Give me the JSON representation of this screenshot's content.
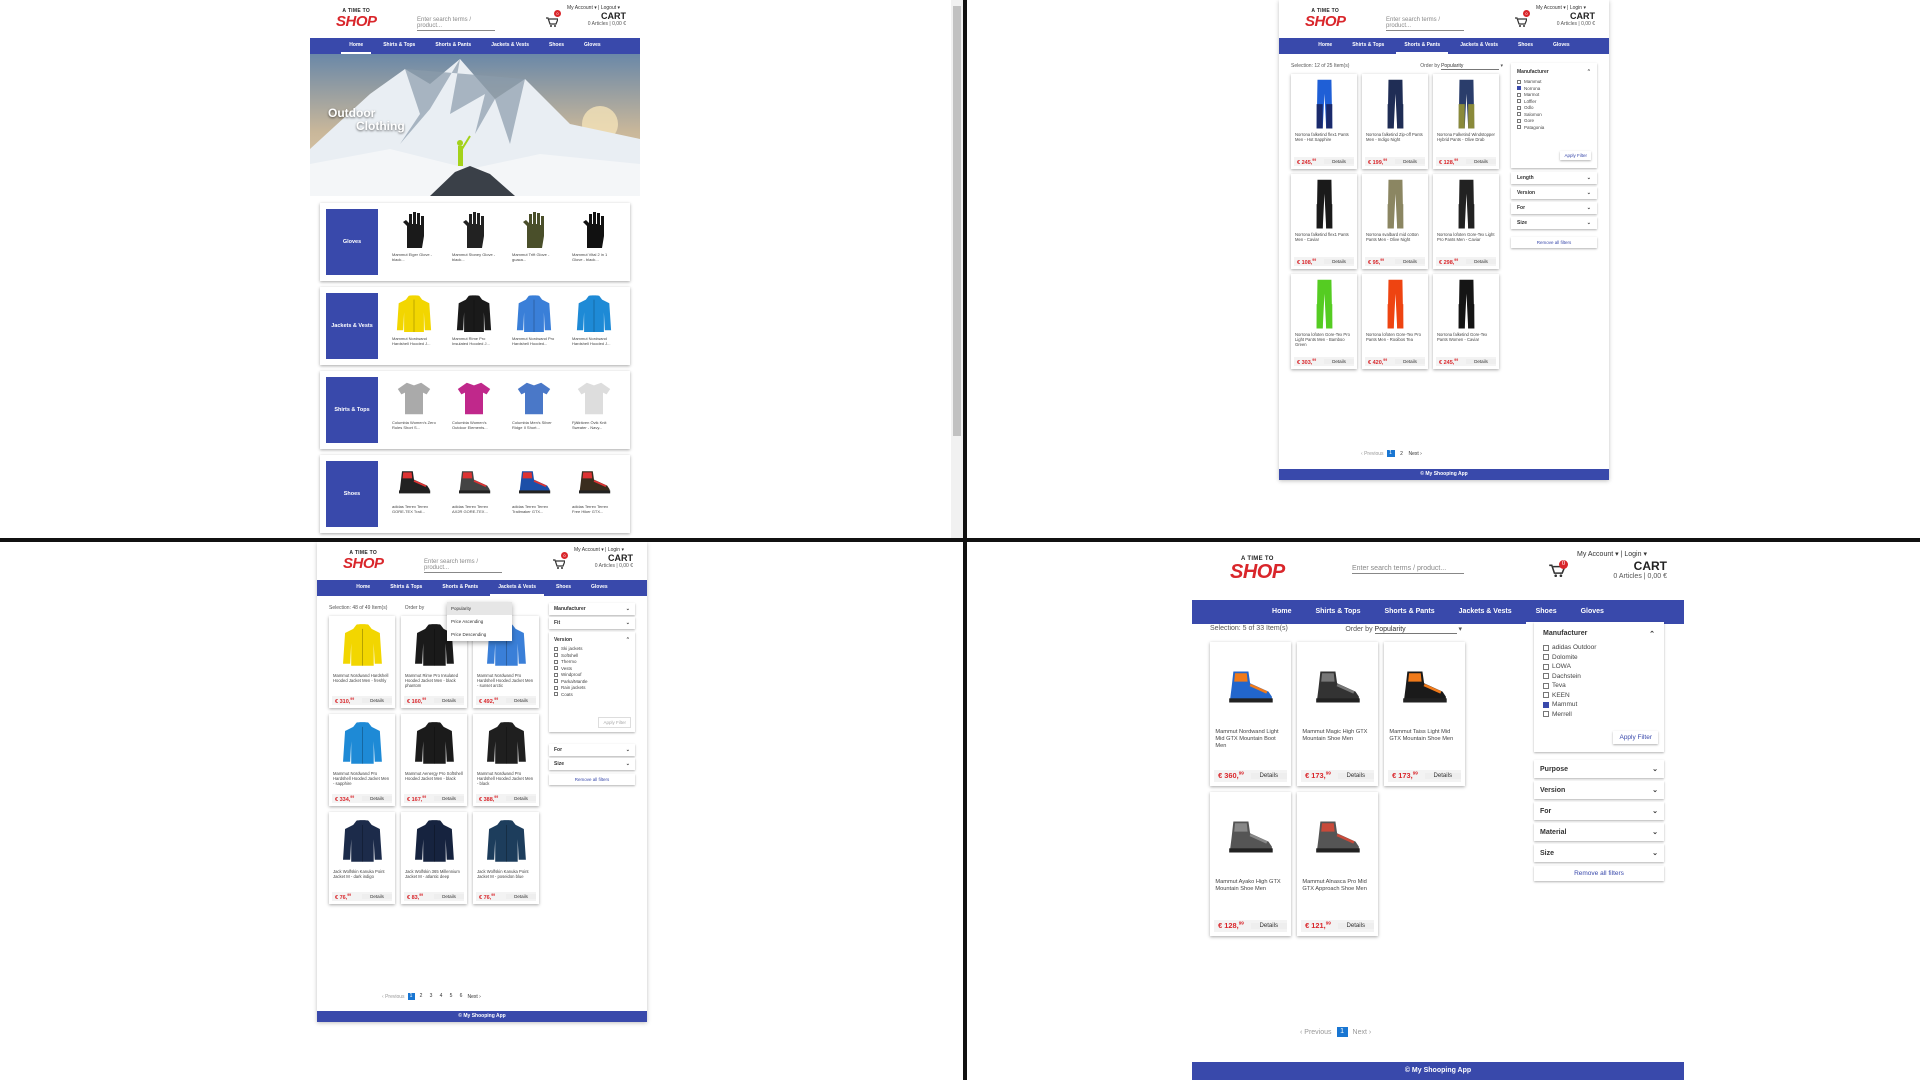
{
  "header": {
    "logo_tag": "A TIME TO",
    "logo_text": "SHOP",
    "search_placeholder": "Enter search terms / product...",
    "my_account": "My Account",
    "logout": "Logout",
    "login": "Login",
    "cart_label": "CART",
    "cart_summary": "0 Articles | 0,00 €",
    "cart_badge": "0"
  },
  "nav": [
    "Home",
    "Shirts & Tops",
    "Shorts & Pants",
    "Jackets & Vests",
    "Shoes",
    "Gloves"
  ],
  "footer": "© My Shooping App",
  "home": {
    "hero_line1": "Outdoor",
    "hero_line2": "Clothing",
    "categories": [
      {
        "label": "Gloves",
        "products": [
          "Mammut Eiger Glove - black...",
          "Mammut Stoney Glove - black...",
          "Mammut Trift Glove - guaca...",
          "Mammut Vital 2 in 1 Glove - black..."
        ]
      },
      {
        "label": "Jackets & Vests",
        "products": [
          "Mammut Nordwand Hardshell Hooded J...",
          "Mammut Rime Pro Insulated Hooded J...",
          "Mammut Nordwand Pro Hardshell Hooded...",
          "Mammut Nordwand Hardshell Hooded J..."
        ]
      },
      {
        "label": "Shirts & Tops",
        "products": [
          "Columbia Women's Zero Rules Short S...",
          "Columbia Women's Outdoor Elements...",
          "Columbia Men's Silver Ridge II Short...",
          "Fjällräven Övik Knit Sweater - Navy..."
        ]
      },
      {
        "label": "Shoes",
        "products": [
          "adidas Terrex Terrex GORE-TEX Trail...",
          "adidas Terrex Terrex AX2R GORE-TEX...",
          "adidas Terrex Terrex Trailmaker GTX...",
          "adidas Terrex Terrex Free Hiker GTX..."
        ]
      }
    ]
  },
  "pants": {
    "selection": "Selection: 12 of 25 Item(s)",
    "order_label": "Order by",
    "order_value": "Popularity",
    "manufacturer_title": "Manufacturer",
    "manufacturers": [
      {
        "name": "Mammut",
        "checked": false
      },
      {
        "name": "Norrona",
        "checked": true
      },
      {
        "name": "Marmot",
        "checked": false
      },
      {
        "name": "Löffler",
        "checked": false
      },
      {
        "name": "Odlo",
        "checked": false
      },
      {
        "name": "Salomon",
        "checked": false
      },
      {
        "name": "Gore",
        "checked": false
      },
      {
        "name": "Patagonia",
        "checked": false
      }
    ],
    "apply": "Apply Filter",
    "filters": [
      "Length",
      "Version",
      "For",
      "Size"
    ],
    "remove_all": "Remove all filters",
    "products": [
      {
        "name": "Norrona falketind flex1 Pants Men - Hot Sapphire",
        "price": "€ 245,",
        "cents": "99",
        "color": "#1f5fd6",
        "accent": "#1a2a6c"
      },
      {
        "name": "Norrona falketind Zip-off Pants Men - Indigo Night",
        "price": "€ 199,",
        "cents": "99",
        "color": "#1f2d55",
        "accent": "#1f2d55"
      },
      {
        "name": "Norrona Falketind Windstopper Hybrid Pants - Olive Drab",
        "price": "€ 128,",
        "cents": "99",
        "color": "#2a3d6b",
        "accent": "#8a8a3a"
      },
      {
        "name": "Norrona falketind flex1 Pants Men - Caviar",
        "price": "€ 108,",
        "cents": "99",
        "color": "#1a1a1a",
        "accent": "#1a1a1a"
      },
      {
        "name": "Norrona svalbard mid cotton Pants Men - Olive Night",
        "price": "€ 95,",
        "cents": "99",
        "color": "#8b8662",
        "accent": "#8b8662"
      },
      {
        "name": "Norrona lofoten Gore-Tex Light Pro Pants Men - Caviar",
        "price": "€ 298,",
        "cents": "99",
        "color": "#222",
        "accent": "#222"
      },
      {
        "name": "Norrona lofoten Gore-Tex Pro Light Pants Men - Bamboo Green",
        "price": "€ 303,",
        "cents": "99",
        "color": "#55cc22",
        "accent": "#55cc22"
      },
      {
        "name": "Norrona lofoten Gore-Tex Pro Pants Men - Rooibos Tea",
        "price": "€ 420,",
        "cents": "99",
        "color": "#ee4411",
        "accent": "#ee4411"
      },
      {
        "name": "Norrona falketind Gore-Tex Pants Women - Caviar",
        "price": "€ 245,",
        "cents": "99",
        "color": "#151515",
        "accent": "#151515"
      }
    ],
    "pagination": {
      "prev": "Previous",
      "pages": [
        "1",
        "2"
      ],
      "next": "Next"
    }
  },
  "jackets": {
    "selection": "Selection: 48 of 49 Item(s)",
    "order_label": "Order by",
    "order_options": [
      "Popularity",
      "Price Ascending",
      "Price Descending"
    ],
    "manufacturer_title": "Manufacturer",
    "fit_title": "Fit",
    "version_title": "Version",
    "versions": [
      "Ski jackets",
      "Softshell",
      "Thermo",
      "Vests",
      "Windproof",
      "Parka/Mantle",
      "Rain jackets",
      "Coats"
    ],
    "apply": "Apply Filter",
    "filters": [
      "For",
      "Size"
    ],
    "remove_all": "Remove all filters",
    "products": [
      {
        "name": "Mammut Nordwand Hardshell Hooded Jacket Men - freshly",
        "price": "€ 310,",
        "cents": "99",
        "color": "#f2d600"
      },
      {
        "name": "Mammut Rime Pro Insulated Hooded Jacket Men - black phantom",
        "price": "€ 160,",
        "cents": "99",
        "color": "#1a1a1a"
      },
      {
        "name": "Mammut Nordwand Pro Hardshell Hooded Jacket Men - sunset arctic",
        "price": "€ 492,",
        "cents": "99",
        "color": "#3a7fd8"
      },
      {
        "name": "Mammut Nordwand Pro Hardshell Hooded Jacket Men - sapphire",
        "price": "€ 334,",
        "cents": "99",
        "color": "#1e8ad6"
      },
      {
        "name": "Mammut Aenergy Pro Softshell Hooded Jacket Men - black",
        "price": "€ 167,",
        "cents": "99",
        "color": "#1b1b1b"
      },
      {
        "name": "Mammut Nordwand Pro Hardshell Hooded Jacket Men - black",
        "price": "€ 388,",
        "cents": "99",
        "color": "#1f1f1f"
      },
      {
        "name": "Jack Wolfskin Kanuka Point Jacket M - dark indigo",
        "price": "€ 76,",
        "cents": "99",
        "color": "#1c2b4a"
      },
      {
        "name": "Jack Wolfskin 365 Millennium Jacket M - atlantic deep",
        "price": "€ 83,",
        "cents": "99",
        "color": "#16233f"
      },
      {
        "name": "Jack Wolfskin Kanuka Point Jacket M - poseidon blue",
        "price": "€ 76,",
        "cents": "99",
        "color": "#1d3d5c"
      }
    ],
    "pagination": {
      "prev": "Previous",
      "pages": [
        "1",
        "2",
        "3",
        "4",
        "5",
        "6"
      ],
      "next": "Next"
    }
  },
  "shoes": {
    "selection": "Selection: 5 of 33 Item(s)",
    "order_label": "Order by",
    "order_value": "Popularity",
    "manufacturer_title": "Manufacturer",
    "manufacturers": [
      {
        "name": "adidas Outdoor",
        "checked": false
      },
      {
        "name": "Dolomite",
        "checked": false
      },
      {
        "name": "LOWA",
        "checked": false
      },
      {
        "name": "Dachstein",
        "checked": false
      },
      {
        "name": "Teva",
        "checked": false
      },
      {
        "name": "KEEN",
        "checked": false
      },
      {
        "name": "Mammut",
        "checked": true
      },
      {
        "name": "Merrell",
        "checked": false
      }
    ],
    "apply": "Apply Filter",
    "filters": [
      "Purpose",
      "Version",
      "For",
      "Material",
      "Size"
    ],
    "remove_all": "Remove all filters",
    "details": "Details",
    "products": [
      {
        "name": "Mammut Nordwand Light Mid GTX Mountain Boot Men",
        "price": "€ 360,",
        "cents": "99",
        "color": "#2266cc",
        "accent": "#f07a1a"
      },
      {
        "name": "Mammut Magic High GTX Mountain Shoe Men",
        "price": "€ 173,",
        "cents": "99",
        "color": "#333",
        "accent": "#777"
      },
      {
        "name": "Mammut Taiss Light Mid GTX Mountain Shoe Men",
        "price": "€ 173,",
        "cents": "99",
        "color": "#1a1a1a",
        "accent": "#f07a1a"
      },
      {
        "name": "Mammut Ayako High GTX Mountain Shoe Men",
        "price": "€ 128,",
        "cents": "99",
        "color": "#555",
        "accent": "#888"
      },
      {
        "name": "Mammut Alnasca Pro Mid GTX Approach Shoe Men",
        "price": "€ 121,",
        "cents": "99",
        "color": "#555",
        "accent": "#c84a3a"
      }
    ],
    "pagination": {
      "prev": "Previous",
      "pages": [
        "1"
      ],
      "next": "Next"
    }
  }
}
